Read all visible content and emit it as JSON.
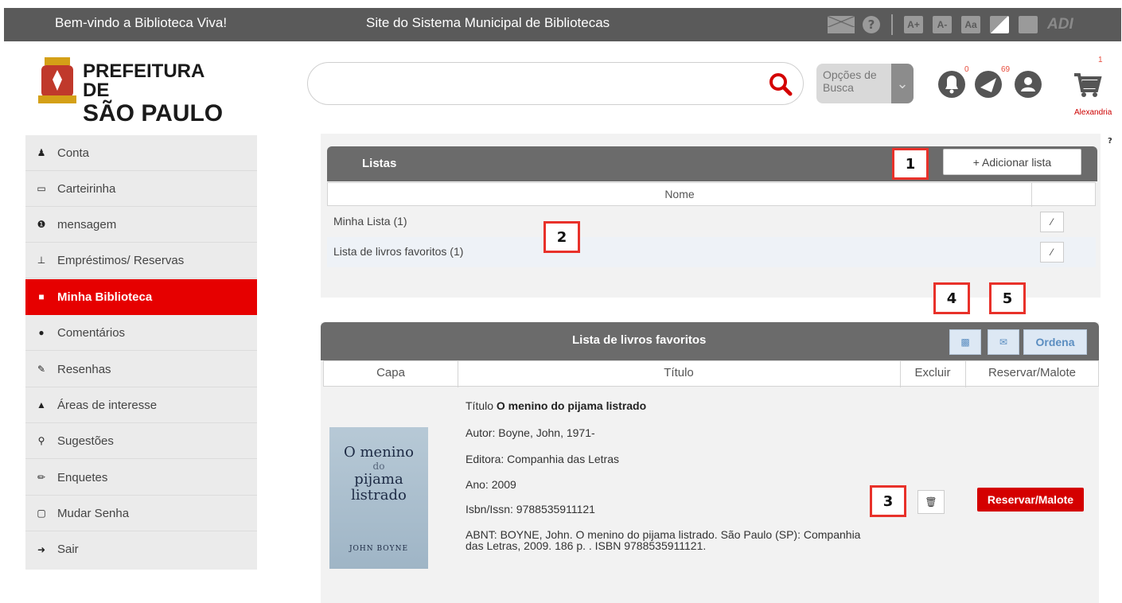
{
  "topbar": {
    "welcome": "Bem-vindo a Biblioteca Viva!",
    "site_link": "Site do Sistema Municipal de Bibliotecas",
    "icons": [
      "mail-icon",
      "help-icon",
      "font-increase-icon",
      "font-decrease-icon",
      "font-reset-icon",
      "contrast-icon",
      "dark-mode-icon",
      "adi-icon"
    ],
    "font_increase": "A+",
    "font_decrease": "A-",
    "font_reset": "Aa",
    "adi": "ADI"
  },
  "header": {
    "logo_line1": "PREFEITURA DE",
    "logo_line2": "SÃO PAULO",
    "search_value": "",
    "search_options_label": "Opções de Busca",
    "notifications_count": "0",
    "messages_count": "69",
    "cart_count": "1",
    "username": "Alexandria",
    "help": "?"
  },
  "sidebar": {
    "items": [
      {
        "label": "Conta",
        "icon": "user-icon"
      },
      {
        "label": "Carteirinha",
        "icon": "card-icon"
      },
      {
        "label": "mensagem",
        "icon": "info-icon"
      },
      {
        "label": "Empréstimos/ Reservas",
        "icon": "pin-icon"
      },
      {
        "label": "Minha Biblioteca",
        "icon": "book-icon"
      },
      {
        "label": "Comentários",
        "icon": "comment-icon"
      },
      {
        "label": "Resenhas",
        "icon": "pencil-icon"
      },
      {
        "label": "Áreas de interesse",
        "icon": "thumbs-up-icon"
      },
      {
        "label": "Sugestões",
        "icon": "lightbulb-icon"
      },
      {
        "label": "Enquetes",
        "icon": "edit-icon"
      },
      {
        "label": "Mudar Senha",
        "icon": "lock-icon"
      },
      {
        "label": "Sair",
        "icon": "sign-out-icon"
      }
    ],
    "active_index": 4
  },
  "listas": {
    "title": "Listas",
    "add_button": "+ Adicionar lista",
    "column_name": "Nome",
    "rows": [
      {
        "label": "Minha Lista (1)"
      },
      {
        "label": "Lista de livros favoritos (1)"
      }
    ]
  },
  "favoritos": {
    "title": "Lista de livros favoritos",
    "sort_button": "Ordena",
    "columns": [
      "Capa",
      "Título",
      "Excluir",
      "Reservar/Malote"
    ],
    "book": {
      "title_prefix": "Título",
      "title": "O menino do pijama listrado",
      "author": "Autor: Boyne, John, 1971-",
      "publisher": "Editora: Companhia das Letras",
      "year": "Ano: 2009",
      "isbn": "Isbn/Issn: 9788535911121",
      "abnt": "ABNT: BOYNE, John. O menino do pijama listrado. São Paulo (SP): Companhia das Letras, 2009. 186 p. . ISBN 9788535911121.",
      "cover_line1": "O menino",
      "cover_line2": "do",
      "cover_line3": "pijama",
      "cover_line4": "listrado",
      "cover_author": "JOHN BOYNE",
      "reserve_button": "Reservar/Malote"
    }
  },
  "callouts": [
    "1",
    "2",
    "3",
    "4",
    "5"
  ]
}
